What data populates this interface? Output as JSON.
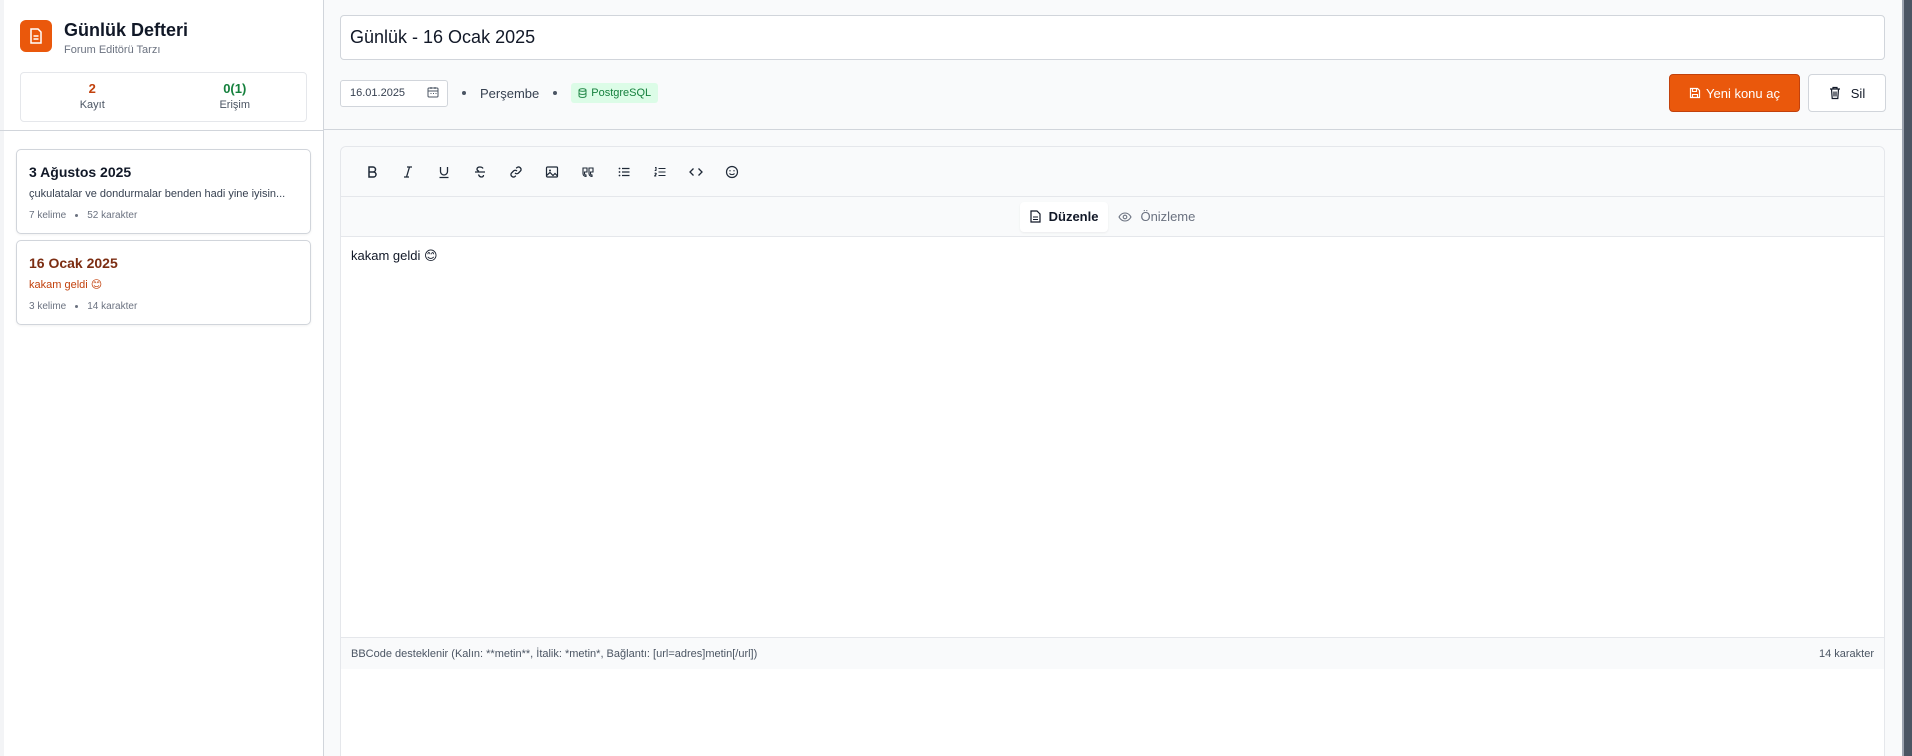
{
  "sidebar": {
    "brand": {
      "title": "Günlük Defteri",
      "subtitle": "Forum Editörü Tarzı"
    },
    "stats": [
      {
        "value": "2",
        "label": "Kayıt"
      },
      {
        "value": "0(1)",
        "label": "Erişim"
      }
    ],
    "entries": [
      {
        "title": "3 Ağustos 2025",
        "excerpt": "çukulatalar ve dondurmalar benden hadi yine iyisin...",
        "words": "7 kelime",
        "chars": "52 karakter"
      },
      {
        "title": "16 Ocak 2025",
        "excerpt": "kakam geldi 😊",
        "words": "3 kelime",
        "chars": "14 karakter"
      }
    ]
  },
  "header": {
    "title": "Günlük - 16 Ocak 2025",
    "date": "16.01.2025",
    "weekday": "Perşembe",
    "db_badge": "PostgreSQL",
    "new_topic_label": "Yeni konu aç",
    "delete_label": "Sil"
  },
  "editor": {
    "tabs": {
      "edit": "Düzenle",
      "preview": "Önizleme"
    },
    "content": "kakam geldi 😊",
    "footer_hint": "BBCode desteklenir (Kalın: **metin**, İtalik: *metin*, Bağlantı: [url=adres]metin[/url])",
    "char_count": "14 karakter"
  },
  "colors": {
    "accent": "#ea580c",
    "success": "#15803d"
  }
}
